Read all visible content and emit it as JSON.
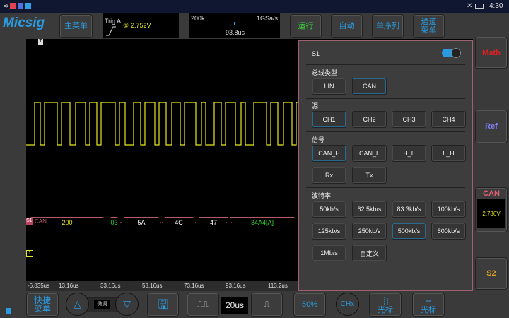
{
  "status": {
    "time": "4:30",
    "icons": [
      "wifi-icon",
      "app-icon",
      "app-icon",
      "app-icon",
      "mute-icon",
      "battery-icon"
    ]
  },
  "brand": "Micsig",
  "toolbar": {
    "main_menu": "主菜单",
    "trig_label": "Trig A",
    "trig_source": "①",
    "trig_level": "2.752V",
    "mem_depth": "200k",
    "sample_rate": "1GSa/s",
    "position": "93.8us",
    "run": "运行",
    "auto": "自动",
    "single": "单序列",
    "channel_menu_1": "通道",
    "channel_menu_2": "菜单"
  },
  "colors": {
    "ch1": "#e6e622",
    "bus": "#b05a6a",
    "accent": "#2a9be0",
    "panel_border": "#a06070"
  },
  "decode": {
    "label": "S1",
    "bus": "CAN",
    "segments": [
      {
        "text": "200",
        "color": "#e6e622"
      },
      {
        "text": "03",
        "color": "#2bd62b"
      },
      {
        "text": "5A",
        "color": "#ffffff"
      },
      {
        "text": "4C",
        "color": "#ffffff"
      },
      {
        "text": "47",
        "color": "#ffffff"
      },
      {
        "text": "34A4[A]",
        "color": "#2bd62b"
      }
    ]
  },
  "ch_marker": "1",
  "axis": [
    "-6.835us",
    "13.16us",
    "33.16us",
    "53.16us",
    "73.16us",
    "93.16us",
    "113.2us"
  ],
  "panel": {
    "title": "S1",
    "enabled": true,
    "bus_type": {
      "label": "总线类型",
      "options": [
        "LIN",
        "CAN"
      ],
      "selected": "CAN"
    },
    "source": {
      "label": "源",
      "options": [
        "CH1",
        "CH2",
        "CH3",
        "CH4"
      ],
      "selected": "CH1"
    },
    "signal": {
      "label": "信号",
      "options": [
        "CAN_H",
        "CAN_L",
        "H_L",
        "L_H",
        "Rx",
        "Tx"
      ],
      "selected": "CAN_H"
    },
    "baud": {
      "label": "波特率",
      "options": [
        "50kb/s",
        "62.5kb/s",
        "83.3kb/s",
        "100kb/s",
        "125kb/s",
        "250kb/s",
        "500kb/s",
        "800kb/s",
        "1Mb/s",
        "自定义"
      ],
      "selected": "500kb/s"
    }
  },
  "right": {
    "math": "Math",
    "ref": "Ref",
    "can": "CAN",
    "can_level": "2.736V",
    "s2": "S2"
  },
  "bottom": {
    "quick_1": "快捷",
    "quick_2": "菜单",
    "fine": "微调",
    "timebase": "20us",
    "fifty": "50%",
    "chx": "CHx",
    "cursor_v": "光标",
    "cursor_h": "光标"
  }
}
